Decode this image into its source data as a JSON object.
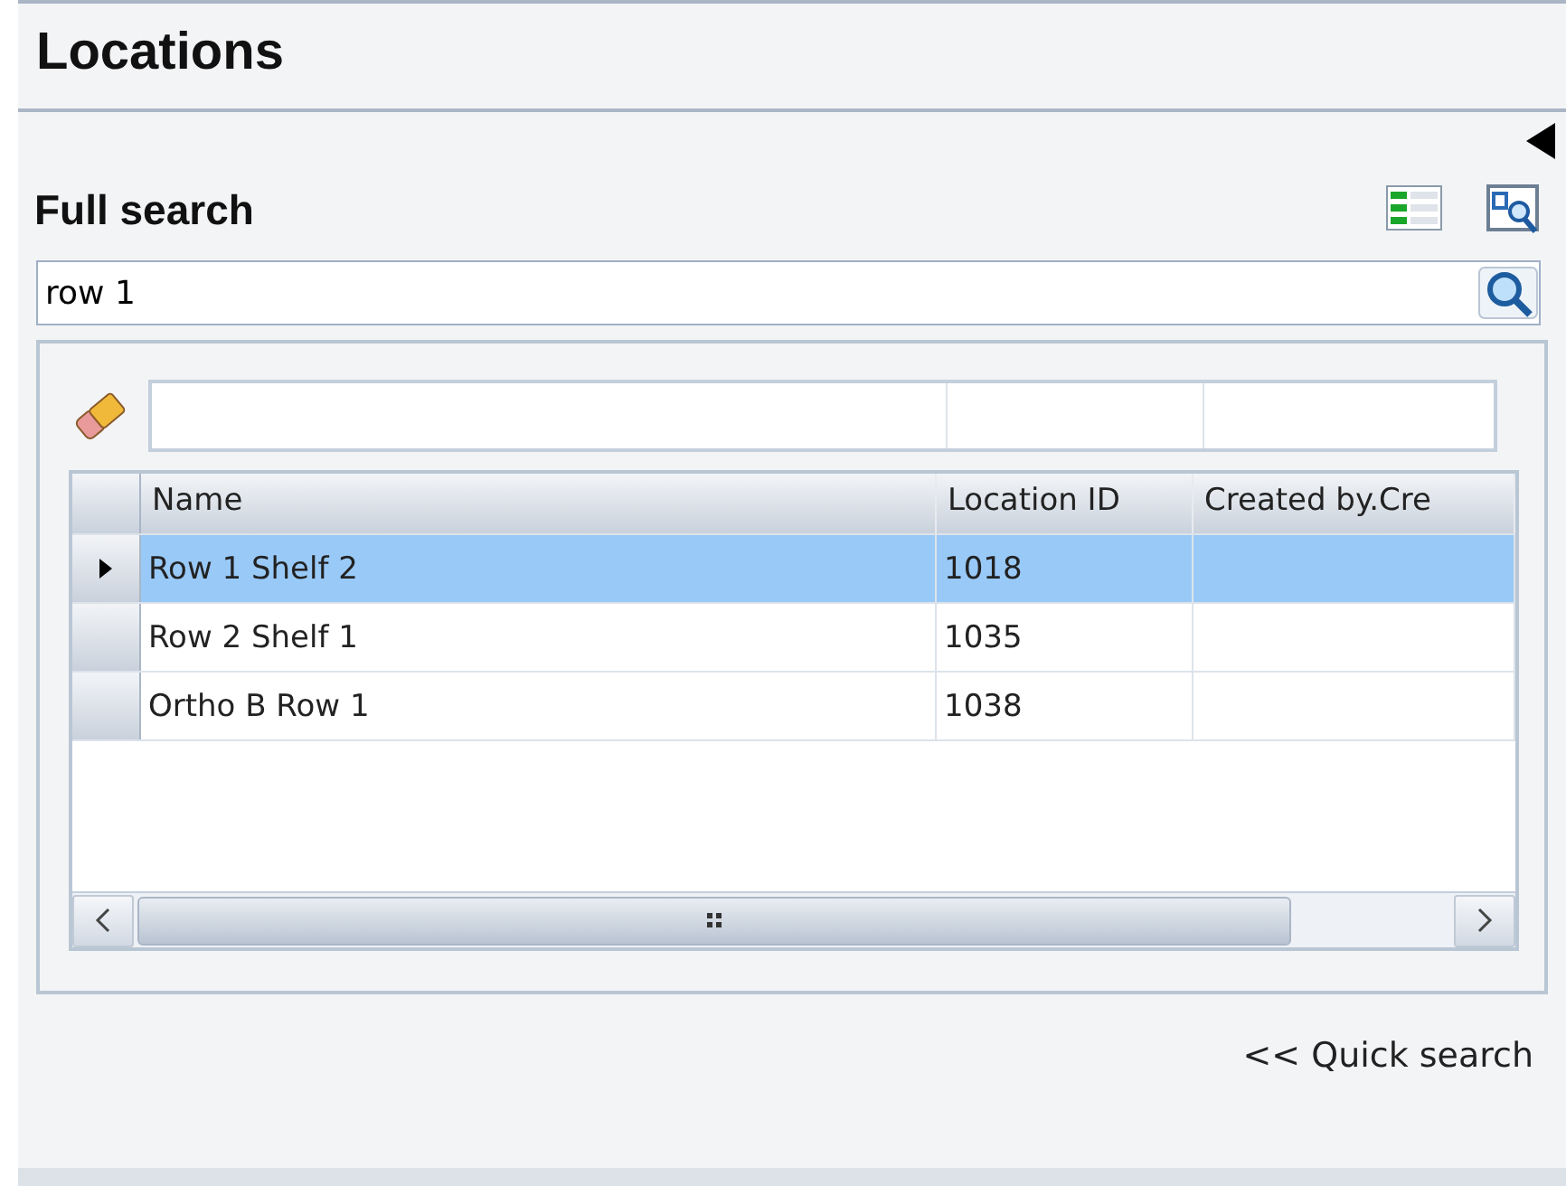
{
  "panel": {
    "title": "Locations"
  },
  "search": {
    "heading": "Full search",
    "value": "row 1"
  },
  "table": {
    "columns": [
      "Name",
      "Location ID",
      "Created by.Cre"
    ],
    "rows": [
      {
        "cells": [
          "Row 1 Shelf 2",
          "1018",
          ""
        ],
        "selected": true
      },
      {
        "cells": [
          "Row 2 Shelf 1",
          "1035",
          ""
        ],
        "selected": false
      },
      {
        "cells": [
          "Ortho B Row 1",
          "1038",
          ""
        ],
        "selected": false
      }
    ]
  },
  "footer_link": "<< Quick search"
}
